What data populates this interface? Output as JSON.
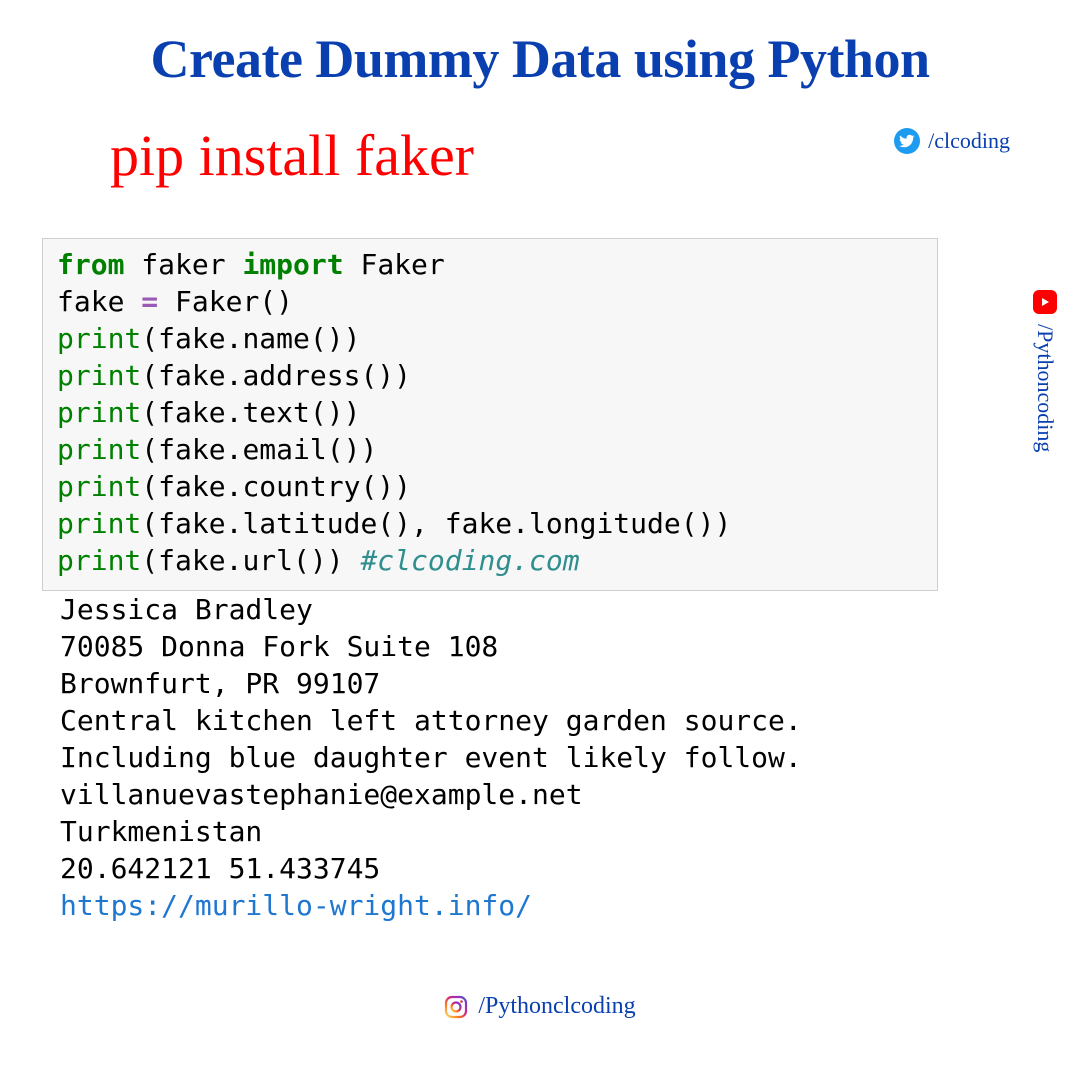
{
  "title": "Create Dummy Data using Python",
  "pip_command": "pip install faker",
  "twitter": {
    "icon": "twitter-icon",
    "handle": "/clcoding"
  },
  "youtube": {
    "icon": "youtube-icon",
    "handle": "/Pythoncoding"
  },
  "instagram": {
    "icon": "instagram-icon",
    "handle": "/Pythonclcoding"
  },
  "code": {
    "kw_from": "from",
    "mod_faker": " faker ",
    "kw_import": "import",
    "cls_faker": " Faker",
    "l2_pre": "fake ",
    "l2_op": "=",
    "l2_post": " Faker()",
    "print": "print",
    "arg_name": "(fake.name())",
    "arg_address": "(fake.address())",
    "arg_text": "(fake.text())",
    "arg_email": "(fake.email())",
    "arg_country": "(fake.country())",
    "arg_latlon": "(fake.latitude(), fake.longitude())",
    "arg_url_pre": "(fake.url()) ",
    "comment": "#clcoding.com"
  },
  "output": {
    "name": "Jessica Bradley",
    "addr1": "70085 Donna Fork Suite 108",
    "addr2": "Brownfurt, PR 99107",
    "text1": "Central kitchen left attorney garden source.",
    "text2": "Including blue daughter event likely follow.",
    "email": "villanuevastephanie@example.net",
    "country": "Turkmenistan",
    "latlon": "20.642121 51.433745",
    "url": "https://murillo-wright.info/"
  }
}
